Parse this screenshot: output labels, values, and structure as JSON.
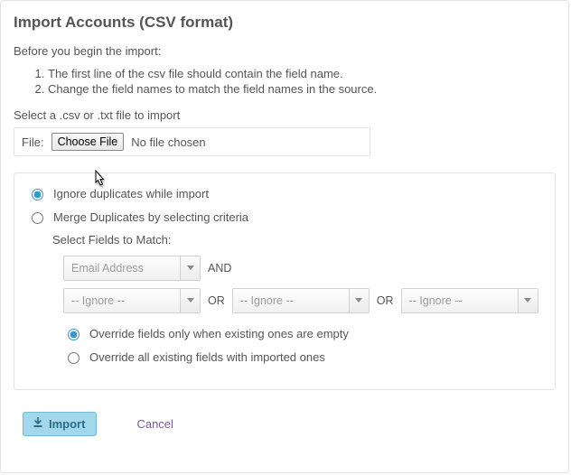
{
  "title": "Import Accounts (CSV format)",
  "intro": "Before you begin the import:",
  "instructions": [
    "The first line of the csv file should contain the field name.",
    "Change the field names to match the field names in the source."
  ],
  "selectFileLabel": "Select a .csv or .txt file to import",
  "filePrefix": "File:",
  "chooseFileLabel": "Choose File",
  "fileStatus": "No file chosen",
  "duplicateOptions": {
    "ignoreLabel": "Ignore duplicates while import",
    "mergeLabel": "Merge Duplicates by selecting criteria",
    "selected": "ignore",
    "selectFieldsLabel": "Select Fields to Match:",
    "match1": "Email Address",
    "connectorAnd": "AND",
    "connectorOr": "OR",
    "match2": "-- Ignore --",
    "match3": "-- Ignore --",
    "match4": "-- Ignore --",
    "overrideOptions": {
      "emptyLabel": "Override fields only when existing ones are empty",
      "allLabel": "Override all existing fields with imported ones",
      "selected": "empty"
    }
  },
  "footer": {
    "importLabel": "Import",
    "cancelLabel": "Cancel"
  }
}
